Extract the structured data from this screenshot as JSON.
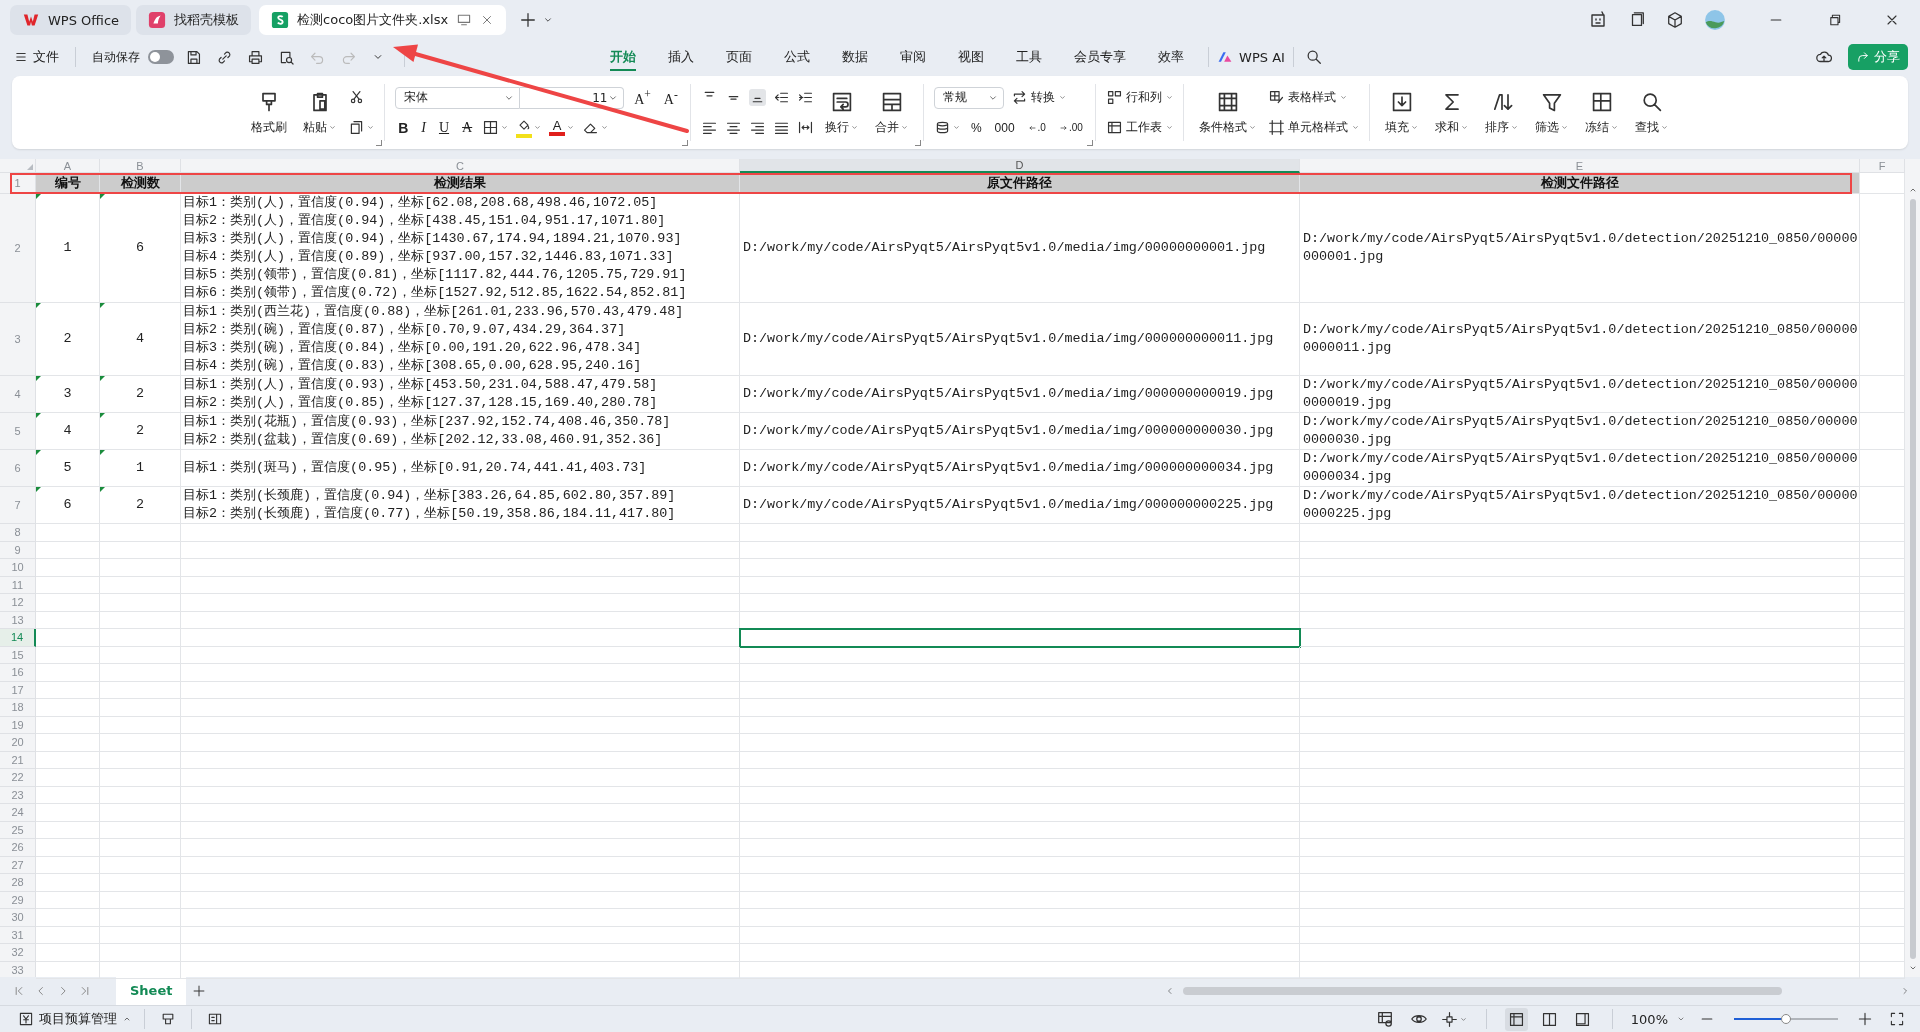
{
  "tabs": [
    {
      "label": "WPS Office",
      "kind": "home",
      "selected": false
    },
    {
      "label": "找稻壳模板",
      "kind": "template",
      "selected": false
    },
    {
      "label": "检测coco图片文件夹.xlsx",
      "kind": "sheet",
      "selected": true
    }
  ],
  "quick_access": {
    "file_menu": "文件",
    "autosave": {
      "label": "自动保存",
      "on": false
    }
  },
  "menu_tabs": [
    {
      "label": "开始",
      "selected": true
    },
    {
      "label": "插入",
      "selected": false
    },
    {
      "label": "页面",
      "selected": false
    },
    {
      "label": "公式",
      "selected": false
    },
    {
      "label": "数据",
      "selected": false
    },
    {
      "label": "审阅",
      "selected": false
    },
    {
      "label": "视图",
      "selected": false
    },
    {
      "label": "工具",
      "selected": false
    },
    {
      "label": "会员专享",
      "selected": false
    },
    {
      "label": "效率",
      "selected": false
    }
  ],
  "ai_button": "WPS AI",
  "share_button": "分享",
  "ribbon": {
    "clipboard": [
      {
        "label": "格式刷",
        "dropdown": false
      },
      {
        "label": "粘贴",
        "dropdown": true
      }
    ],
    "font": {
      "name": "宋体",
      "size": "11",
      "grow": "A$^{+}$",
      "shrink": "A$^{-}$"
    },
    "text_styles": [
      {
        "label": "B"
      },
      {
        "label": "I"
      },
      {
        "label": "U"
      },
      {
        "label": "A"
      }
    ],
    "fill_color": {
      "color": "#f2e01a"
    },
    "font_color": {
      "label": "A",
      "color": "#e0201c"
    },
    "vertical_align": [
      {
        "selected": false
      },
      {
        "selected": false
      },
      {
        "selected": true
      }
    ],
    "text_controls": [
      {
        "label": "换行",
        "dropdown": true
      },
      {
        "label": "合并",
        "dropdown": true
      }
    ],
    "number_format": "常规",
    "convert": "转换",
    "number_buttons": [
      {
        "label": "%"
      },
      {
        "label": "000"
      }
    ],
    "decimal_buttons": [
      {
        "label": ".0"
      },
      {
        "label": ".00"
      }
    ],
    "rows_sheets": [
      "行和列",
      "工作表"
    ],
    "conditional": "条件格式",
    "styles": [
      "表格样式",
      "单元格样式"
    ],
    "editing": [
      "填充",
      "求和",
      "排序",
      "筛选",
      "冻结",
      "查找"
    ]
  },
  "sheet": {
    "columns": [
      {
        "label": "A",
        "selected": false
      },
      {
        "label": "B",
        "selected": false
      },
      {
        "label": "C",
        "selected": false
      },
      {
        "label": "D",
        "selected": true
      },
      {
        "label": "E",
        "selected": false
      },
      {
        "label": "F",
        "selected": false
      }
    ],
    "rows": [
      {
        "number": "1",
        "kind": "header",
        "selected": false,
        "cells": [
          "编号",
          "检测数",
          "检测结果",
          "原文件路径",
          "检测文件路径"
        ]
      },
      {
        "number": "2",
        "kind": "data",
        "selected": false,
        "flagged": true,
        "cells": [
          "1",
          "6",
          "目标1：类别(人)，置信度(0.94)，坐标[62.08,208.68,498.46,1072.05]\n目标2：类别(人)，置信度(0.94)，坐标[438.45,151.04,951.17,1071.80]\n目标3：类别(人)，置信度(0.94)，坐标[1430.67,174.94,1894.21,1070.93]\n目标4：类别(人)，置信度(0.89)，坐标[937.00,157.32,1446.83,1071.33]\n目标5：类别(领带)，置信度(0.81)，坐标[1117.82,444.76,1205.75,729.91]\n目标6：类别(领带)，置信度(0.72)，坐标[1527.92,512.85,1622.54,852.81]",
          "D:/work/my/code/AirsPyqt5/AirsPyqt5v1.0/media/img/00000000001.jpg",
          "D:/work/my/code/AirsPyqt5/AirsPyqt5v1.0/detection/20251210_0850/00000000001.jpg"
        ]
      },
      {
        "number": "3",
        "kind": "data",
        "selected": false,
        "flagged": true,
        "cells": [
          "2",
          "4",
          "目标1：类别(西兰花)，置信度(0.88)，坐标[261.01,233.96,570.43,479.48]\n目标2：类别(碗)，置信度(0.87)，坐标[0.70,9.07,434.29,364.37]\n目标3：类别(碗)，置信度(0.84)，坐标[0.00,191.20,622.96,478.34]\n目标4：类别(碗)，置信度(0.83)，坐标[308.65,0.00,628.95,240.16]",
          "D:/work/my/code/AirsPyqt5/AirsPyqt5v1.0/media/img/000000000011.jpg",
          "D:/work/my/code/AirsPyqt5/AirsPyqt5v1.0/detection/20251210_0850/000000000011.jpg"
        ]
      },
      {
        "number": "4",
        "kind": "data",
        "selected": false,
        "flagged": true,
        "cells": [
          "3",
          "2",
          "目标1：类别(人)，置信度(0.93)，坐标[453.50,231.04,588.47,479.58]\n目标2：类别(人)，置信度(0.85)，坐标[127.37,128.15,169.40,280.78]",
          "D:/work/my/code/AirsPyqt5/AirsPyqt5v1.0/media/img/000000000019.jpg",
          "D:/work/my/code/AirsPyqt5/AirsPyqt5v1.0/detection/20251210_0850/000000000019.jpg"
        ]
      },
      {
        "number": "5",
        "kind": "data",
        "selected": false,
        "flagged": true,
        "cells": [
          "4",
          "2",
          "目标1：类别(花瓶)，置信度(0.93)，坐标[237.92,152.74,408.46,350.78]\n目标2：类别(盆栽)，置信度(0.69)，坐标[202.12,33.08,460.91,352.36]",
          "D:/work/my/code/AirsPyqt5/AirsPyqt5v1.0/media/img/000000000030.jpg",
          "D:/work/my/code/AirsPyqt5/AirsPyqt5v1.0/detection/20251210_0850/000000000030.jpg"
        ]
      },
      {
        "number": "6",
        "kind": "data",
        "selected": false,
        "flagged": true,
        "cells": [
          "5",
          "1",
          "目标1：类别(斑马)，置信度(0.95)，坐标[0.91,20.74,441.41,403.73]",
          "D:/work/my/code/AirsPyqt5/AirsPyqt5v1.0/media/img/000000000034.jpg",
          "D:/work/my/code/AirsPyqt5/AirsPyqt5v1.0/detection/20251210_0850/000000000034.jpg"
        ]
      },
      {
        "number": "7",
        "kind": "data",
        "selected": false,
        "flagged": true,
        "cells": [
          "6",
          "2",
          "目标1：类别(长颈鹿)，置信度(0.94)，坐标[383.26,64.85,602.80,357.89]\n目标2：类别(长颈鹿)，置信度(0.77)，坐标[50.19,358.86,184.11,417.80]",
          "D:/work/my/code/AirsPyqt5/AirsPyqt5v1.0/media/img/000000000225.jpg",
          "D:/work/my/code/AirsPyqt5/AirsPyqt5v1.0/detection/20251210_0850/000000000225.jpg"
        ]
      },
      {
        "number": "8",
        "kind": "empty",
        "selected": false
      },
      {
        "number": "9",
        "kind": "empty",
        "selected": false
      },
      {
        "number": "10",
        "kind": "empty",
        "selected": false
      },
      {
        "number": "11",
        "kind": "empty",
        "selected": false
      },
      {
        "number": "12",
        "kind": "empty",
        "selected": false
      },
      {
        "number": "13",
        "kind": "empty",
        "selected": false
      },
      {
        "number": "14",
        "kind": "empty",
        "selected": true
      },
      {
        "number": "15",
        "kind": "empty",
        "selected": false
      },
      {
        "number": "16",
        "kind": "empty",
        "selected": false
      },
      {
        "number": "17",
        "kind": "empty",
        "selected": false
      },
      {
        "number": "18",
        "kind": "empty",
        "selected": false
      },
      {
        "number": "19",
        "kind": "empty",
        "selected": false
      },
      {
        "number": "20",
        "kind": "empty",
        "selected": false
      },
      {
        "number": "21",
        "kind": "empty",
        "selected": false
      },
      {
        "number": "22",
        "kind": "empty",
        "selected": false
      },
      {
        "number": "23",
        "kind": "empty",
        "selected": false
      },
      {
        "number": "24",
        "kind": "empty",
        "selected": false
      },
      {
        "number": "25",
        "kind": "empty",
        "selected": false
      },
      {
        "number": "26",
        "kind": "empty",
        "selected": false
      },
      {
        "number": "27",
        "kind": "empty",
        "selected": false
      },
      {
        "number": "28",
        "kind": "empty",
        "selected": false
      },
      {
        "number": "29",
        "kind": "empty",
        "selected": false
      },
      {
        "number": "30",
        "kind": "empty",
        "selected": false
      },
      {
        "number": "31",
        "kind": "empty",
        "selected": false
      },
      {
        "number": "32",
        "kind": "empty",
        "selected": false
      },
      {
        "number": "33",
        "kind": "empty",
        "selected": false
      }
    ]
  },
  "sheet_tabs": [
    {
      "label": "Sheet",
      "selected": true
    }
  ],
  "status_bar": {
    "workspace": "项目预算管理",
    "view_modes": [
      {
        "selected": true
      },
      {
        "selected": false
      },
      {
        "selected": false
      }
    ],
    "zoom": {
      "reading": "100%",
      "level": 0.5
    }
  },
  "annotations": {
    "highlight_box": true,
    "arrow": true
  }
}
